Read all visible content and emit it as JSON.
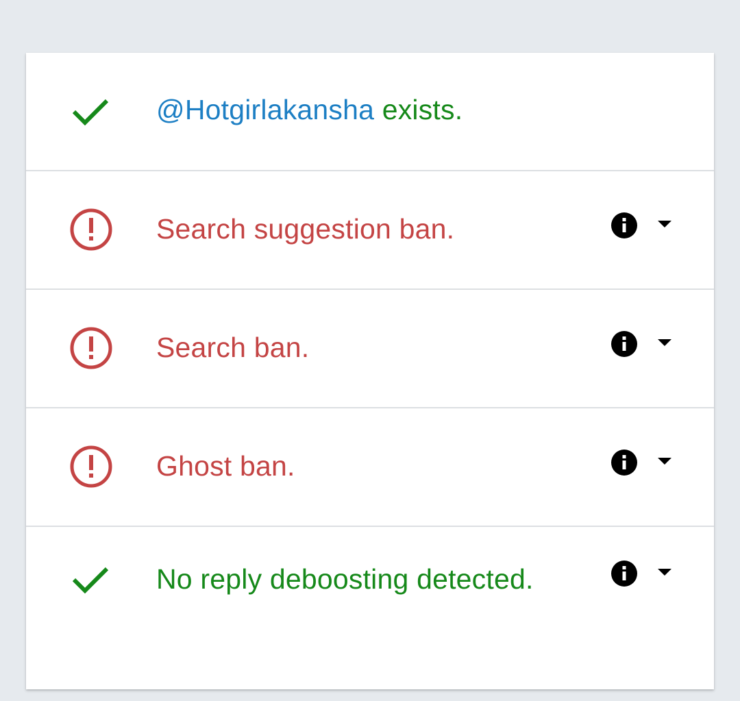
{
  "colors": {
    "page_background": "#e6eaee",
    "card_background": "#ffffff",
    "success_green": "#16891a",
    "error_red": "#c44444",
    "handle_blue": "#1d7fc4",
    "info_icon": "#000000"
  },
  "results": [
    {
      "status": "ok",
      "icon": "check-icon",
      "handle": "@Hotgirlakansha",
      "text": " exists."
    },
    {
      "status": "bad",
      "icon": "alert-circle-icon",
      "text": "Search suggestion ban.",
      "has_details": true
    },
    {
      "status": "bad",
      "icon": "alert-circle-icon",
      "text": "Search ban.",
      "has_details": true
    },
    {
      "status": "bad",
      "icon": "alert-circle-icon",
      "text": "Ghost ban.",
      "has_details": true
    },
    {
      "status": "ok",
      "icon": "check-icon",
      "text": "No reply deboosting detected.",
      "has_details": true
    }
  ]
}
